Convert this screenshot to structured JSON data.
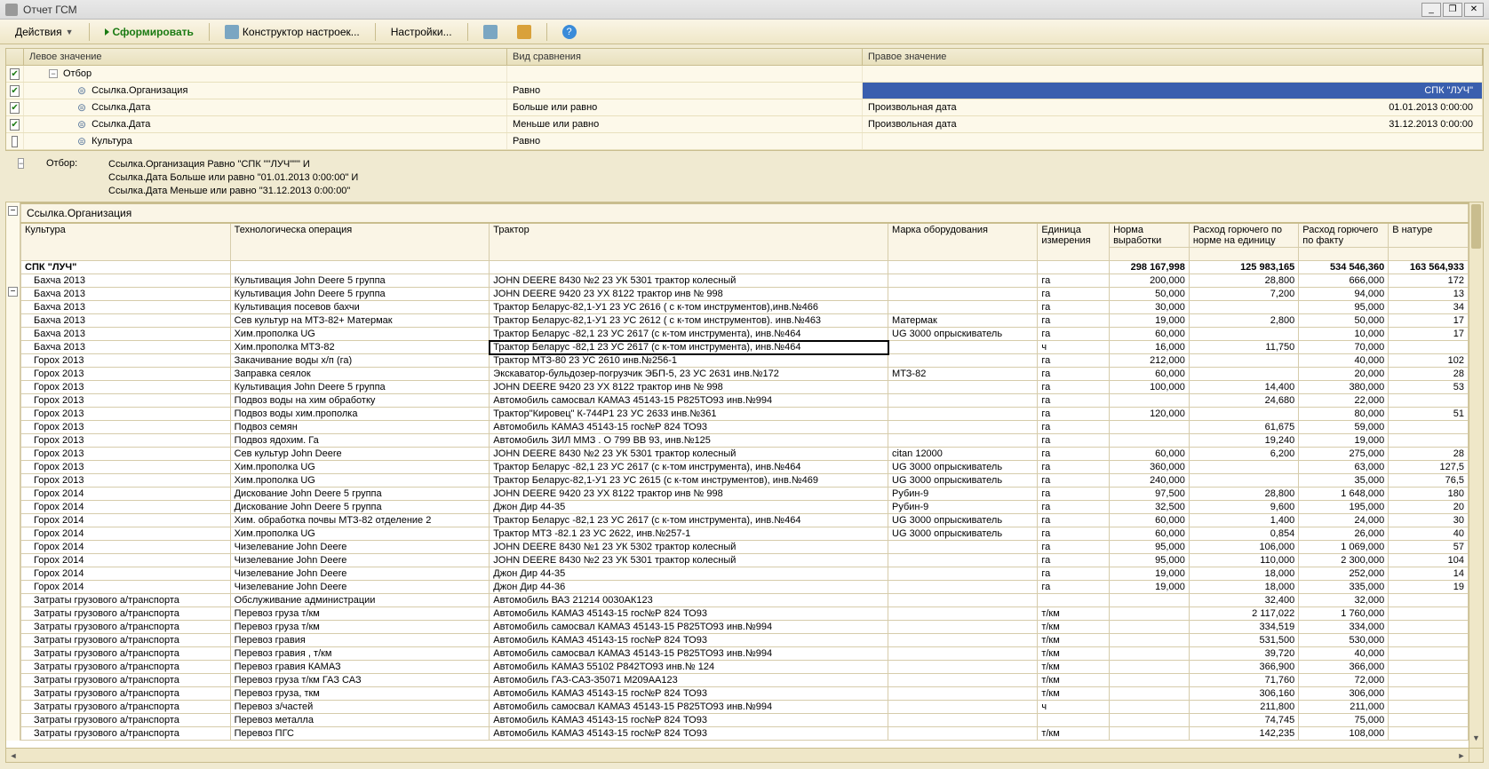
{
  "window": {
    "title": "Отчет ГСМ"
  },
  "toolbar": {
    "actions": "Действия",
    "form": "Сформировать",
    "ctor": "Конструктор настроек...",
    "settings": "Настройки..."
  },
  "filter": {
    "cols": {
      "left": "Левое значение",
      "cmp": "Вид сравнения",
      "right": "Правое значение"
    },
    "group_label": "Отбор",
    "rows": [
      {
        "chk": true,
        "left": "Ссылка.Организация",
        "cmp": "Равно",
        "rtype": "",
        "rval": "СПК \"ЛУЧ\"",
        "sel": true
      },
      {
        "chk": true,
        "left": "Ссылка.Дата",
        "cmp": "Больше или равно",
        "rtype": "Произвольная дата",
        "rval": "01.01.2013 0:00:00"
      },
      {
        "chk": true,
        "left": "Ссылка.Дата",
        "cmp": "Меньше или равно",
        "rtype": "Произвольная дата",
        "rval": "31.12.2013 0:00:00"
      },
      {
        "chk": false,
        "left": "Культура",
        "cmp": "Равно",
        "rtype": "",
        "rval": ""
      }
    ]
  },
  "summary": {
    "label": "Отбор:",
    "lines": [
      "Ссылка.Организация Равно \"СПК \"\"ЛУЧ\"\"\" И",
      "Ссылка.Дата Больше или равно \"01.01.2013 0:00:00\" И",
      "Ссылка.Дата Меньше или равно \"31.12.2013 0:00:00\""
    ]
  },
  "report": {
    "org_header": "Ссылка.Организация",
    "cols": {
      "culture": "Культура",
      "oper": "Технологическа операция",
      "tractor": "Трактор",
      "equip": "Марка оборудования",
      "unit": "Единица измерения",
      "norm": "Норма выработки",
      "rate": "Расход горючего по норме на единицу",
      "fact": "Расход горючего по факту",
      "nat": "В натуре"
    },
    "group_name": "СПК \"ЛУЧ\"",
    "totals": {
      "norm": "298 167,998",
      "rate": "125 983,165",
      "fact": "534 546,360",
      "nat": "163 564,933"
    },
    "selected_row_index": 5,
    "rows": [
      {
        "c": "Бахча 2013",
        "o": "Культивация John Deere 5 группа",
        "t": "JOHN  DEERE 8430 №2  23 УК  5301  трактор колесный",
        "e": "",
        "u": "га",
        "n": "200,000",
        "r": "28,800",
        "f": "666,000",
        "x": "172"
      },
      {
        "c": "Бахча 2013",
        "o": "Культивация John Deere 5 группа",
        "t": "JOHN  DEERE 9420   23 УХ  8122  трактор инв № 998",
        "e": "",
        "u": "га",
        "n": "50,000",
        "r": "7,200",
        "f": "94,000",
        "x": "13"
      },
      {
        "c": "Бахча 2013",
        "o": "Культивация посевов бахчи",
        "t": "Трактор Беларус-82,1-У1 23 УС 2616  ( с к-том инструментов),инв.№466",
        "e": "",
        "u": "га",
        "n": "30,000",
        "r": "",
        "f": "95,000",
        "x": "34"
      },
      {
        "c": "Бахча 2013",
        "o": "Сев культур на МТЗ-82+ Матермак",
        "t": "Трактор Беларус-82,1-У1  23 УС 2612 ( с к-том инструментов). инв.№463",
        "e": "Матермак",
        "u": "га",
        "n": "19,000",
        "r": "2,800",
        "f": "50,000",
        "x": "17"
      },
      {
        "c": "Бахча 2013",
        "o": "Хим.прополка UG",
        "t": "Трактор Беларус -82,1  23 УС 2617 (с к-том инструмента), инв.№464",
        "e": "UG 3000 опрыскиватель",
        "u": "га",
        "n": "60,000",
        "r": "",
        "f": "10,000",
        "x": "17"
      },
      {
        "c": "Бахча 2013",
        "o": "Хим.прополка МТЗ-82",
        "t": "Трактор Беларус -82,1  23 УС 2617 (с к-том инструмента), инв.№464",
        "e": "",
        "u": "ч",
        "n": "16,000",
        "r": "11,750",
        "f": "70,000",
        "x": ""
      },
      {
        "c": "Горох 2013",
        "o": "Закачивание воды х/п (га)",
        "t": "Трактор МТЗ-80   23 УС 2610 инв.№256-1",
        "e": "",
        "u": "га",
        "n": "212,000",
        "r": "",
        "f": "40,000",
        "x": "102"
      },
      {
        "c": "Горох 2013",
        "o": "Заправка сеялок",
        "t": "Экскаватор-бульдозер-погрузчик ЭБП-5,  23 УС 2631  инв.№172",
        "e": "МТЗ-82",
        "u": "га",
        "n": "60,000",
        "r": "",
        "f": "20,000",
        "x": "28"
      },
      {
        "c": "Горох 2013",
        "o": "Культивация John Deere 5 группа",
        "t": "JOHN  DEERE 9420   23 УХ  8122  трактор инв № 998",
        "e": "",
        "u": "га",
        "n": "100,000",
        "r": "14,400",
        "f": "380,000",
        "x": "53"
      },
      {
        "c": "Горох 2013",
        "o": "Подвоз воды на хим обработку",
        "t": "Автомобиль самосвал КАМАЗ 45143-15  Р825ТО93  инв.№994",
        "e": "",
        "u": "га",
        "n": "",
        "r": "24,680",
        "f": "22,000",
        "x": ""
      },
      {
        "c": "Горох 2013",
        "o": "Подвоз воды хим.прополка",
        "t": "Трактор\"Кировец\" К-744Р1  23 УС 2633   инв.№361",
        "e": "",
        "u": "га",
        "n": "120,000",
        "r": "",
        "f": "80,000",
        "x": "51"
      },
      {
        "c": "Горох 2013",
        "o": "Подвоз семян",
        "t": "Автомобиль КАМАЗ 45143-15 гос№Р 824 ТО93",
        "e": "",
        "u": "га",
        "n": "",
        "r": "61,675",
        "f": "59,000",
        "x": ""
      },
      {
        "c": "Горох 2013",
        "o": "Подвоз ядохим. Га",
        "t": "Автомобиль ЗИЛ ММЗ  . О 799 ВВ 93, инв.№125",
        "e": "",
        "u": "га",
        "n": "",
        "r": "19,240",
        "f": "19,000",
        "x": ""
      },
      {
        "c": "Горох 2013",
        "o": "Сев культур John Deere",
        "t": "JOHN  DEERE 8430 №2  23 УК  5301  трактор колесный",
        "e": "citan 12000",
        "u": "га",
        "n": "60,000",
        "r": "6,200",
        "f": "275,000",
        "x": "28"
      },
      {
        "c": "Горох 2013",
        "o": "Хим.прополка UG",
        "t": "Трактор Беларус -82,1  23 УС 2617 (с к-том инструмента), инв.№464",
        "e": "UG 3000 опрыскиватель",
        "u": "га",
        "n": "360,000",
        "r": "",
        "f": "63,000",
        "x": "127,5"
      },
      {
        "c": "Горох 2013",
        "o": "Хим.прополка UG",
        "t": "Трактор Беларус-82,1-У1  23 УС 2615  (с к-том инструментов), инв.№469",
        "e": "UG 3000 опрыскиватель",
        "u": "га",
        "n": "240,000",
        "r": "",
        "f": "35,000",
        "x": "76,5"
      },
      {
        "c": "Горох 2014",
        "o": "Дискование John Deere 5 группа",
        "t": "JOHN  DEERE 9420   23 УХ  8122  трактор инв № 998",
        "e": "Рубин-9",
        "u": "га",
        "n": "97,500",
        "r": "28,800",
        "f": "1 648,000",
        "x": "180"
      },
      {
        "c": "Горох 2014",
        "o": "Дискование John Deere 5 группа",
        "t": "Джон Дир 44-35",
        "e": "Рубин-9",
        "u": "га",
        "n": "32,500",
        "r": "9,600",
        "f": "195,000",
        "x": "20"
      },
      {
        "c": "Горох 2014",
        "o": "Хим. обработка почвы МТЗ-82 отделение 2",
        "t": "Трактор Беларус -82,1  23 УС 2617 (с к-том инструмента), инв.№464",
        "e": "UG 3000 опрыскиватель",
        "u": "га",
        "n": "60,000",
        "r": "1,400",
        "f": "24,000",
        "x": "30"
      },
      {
        "c": "Горох 2014",
        "o": "Хим.прополка UG",
        "t": "Трактор МТЗ -82.1   23 УС 2622, инв.№257-1",
        "e": "UG 3000 опрыскиватель",
        "u": "га",
        "n": "60,000",
        "r": "0,854",
        "f": "26,000",
        "x": "40"
      },
      {
        "c": "Горох 2014",
        "o": "Чизелевание John Deere",
        "t": "JOHN  DEERE 8430 №1   23 УК 5302  трактор колесный",
        "e": "",
        "u": "га",
        "n": "95,000",
        "r": "106,000",
        "f": "1 069,000",
        "x": "57"
      },
      {
        "c": "Горох 2014",
        "o": "Чизелевание John Deere",
        "t": "JOHN  DEERE 8430 №2  23 УК  5301  трактор колесный",
        "e": "",
        "u": "га",
        "n": "95,000",
        "r": "110,000",
        "f": "2 300,000",
        "x": "104"
      },
      {
        "c": "Горох 2014",
        "o": "Чизелевание John Deere",
        "t": "Джон Дир 44-35",
        "e": "",
        "u": "га",
        "n": "19,000",
        "r": "18,000",
        "f": "252,000",
        "x": "14"
      },
      {
        "c": "Горох 2014",
        "o": "Чизелевание John Deere",
        "t": "Джон Дир 44-36",
        "e": "",
        "u": "га",
        "n": "19,000",
        "r": "18,000",
        "f": "335,000",
        "x": "19"
      },
      {
        "c": "Затраты грузового а/транспорта",
        "o": "Обслуживание администрации",
        "t": "Автомобиль ВАЗ 21214  0030АК123",
        "e": "",
        "u": "",
        "n": "",
        "r": "32,400",
        "f": "32,000",
        "x": ""
      },
      {
        "c": "Затраты грузового а/транспорта",
        "o": "Перевоз  груза  т/км",
        "t": "Автомобиль КАМАЗ 45143-15 гос№Р 824 ТО93",
        "e": "",
        "u": "т/км",
        "n": "",
        "r": "2 117,022",
        "f": "1 760,000",
        "x": ""
      },
      {
        "c": "Затраты грузового а/транспорта",
        "o": "Перевоз  груза  т/км",
        "t": "Автомобиль самосвал КАМАЗ 45143-15  Р825ТО93  инв.№994",
        "e": "",
        "u": "т/км",
        "n": "",
        "r": "334,519",
        "f": "334,000",
        "x": ""
      },
      {
        "c": "Затраты грузового а/транспорта",
        "o": "Перевоз гравия",
        "t": "Автомобиль КАМАЗ 45143-15 гос№Р 824 ТО93",
        "e": "",
        "u": "т/км",
        "n": "",
        "r": "531,500",
        "f": "530,000",
        "x": ""
      },
      {
        "c": "Затраты грузового а/транспорта",
        "o": "Перевоз гравия  , т/км",
        "t": "Автомобиль самосвал КАМАЗ 45143-15  Р825ТО93  инв.№994",
        "e": "",
        "u": "т/км",
        "n": "",
        "r": "39,720",
        "f": "40,000",
        "x": ""
      },
      {
        "c": "Затраты грузового а/транспорта",
        "o": "Перевоз гравия КАМАЗ",
        "t": "Автомобиль КАМАЗ 55102   Р842ТО93 инв.№ 124",
        "e": "",
        "u": "т/км",
        "n": "",
        "r": "366,900",
        "f": "366,000",
        "x": ""
      },
      {
        "c": "Затраты грузового а/транспорта",
        "o": "Перевоз груза т/км ГАЗ САЗ",
        "t": "Автомобиль ГАЗ-САЗ-35071 М209АА123",
        "e": "",
        "u": "т/км",
        "n": "",
        "r": "71,760",
        "f": "72,000",
        "x": ""
      },
      {
        "c": "Затраты грузового а/транспорта",
        "o": "Перевоз груза, ткм",
        "t": "Автомобиль КАМАЗ 45143-15 гос№Р 824 ТО93",
        "e": "",
        "u": "т/км",
        "n": "",
        "r": "306,160",
        "f": "306,000",
        "x": ""
      },
      {
        "c": "Затраты грузового а/транспорта",
        "o": "Перевоз з/частей",
        "t": "Автомобиль самосвал КАМАЗ 45143-15  Р825ТО93  инв.№994",
        "e": "",
        "u": "ч",
        "n": "",
        "r": "211,800",
        "f": "211,000",
        "x": ""
      },
      {
        "c": "Затраты грузового а/транспорта",
        "o": "Перевоз металла",
        "t": "Автомобиль КАМАЗ 45143-15 гос№Р 824 ТО93",
        "e": "",
        "u": "",
        "n": "",
        "r": "74,745",
        "f": "75,000",
        "x": ""
      },
      {
        "c": "Затраты грузового а/транспорта",
        "o": "Перевоз ПГС",
        "t": "Автомобиль КАМАЗ 45143-15 гос№Р 824 ТО93",
        "e": "",
        "u": "т/км",
        "n": "",
        "r": "142,235",
        "f": "108,000",
        "x": ""
      }
    ]
  }
}
